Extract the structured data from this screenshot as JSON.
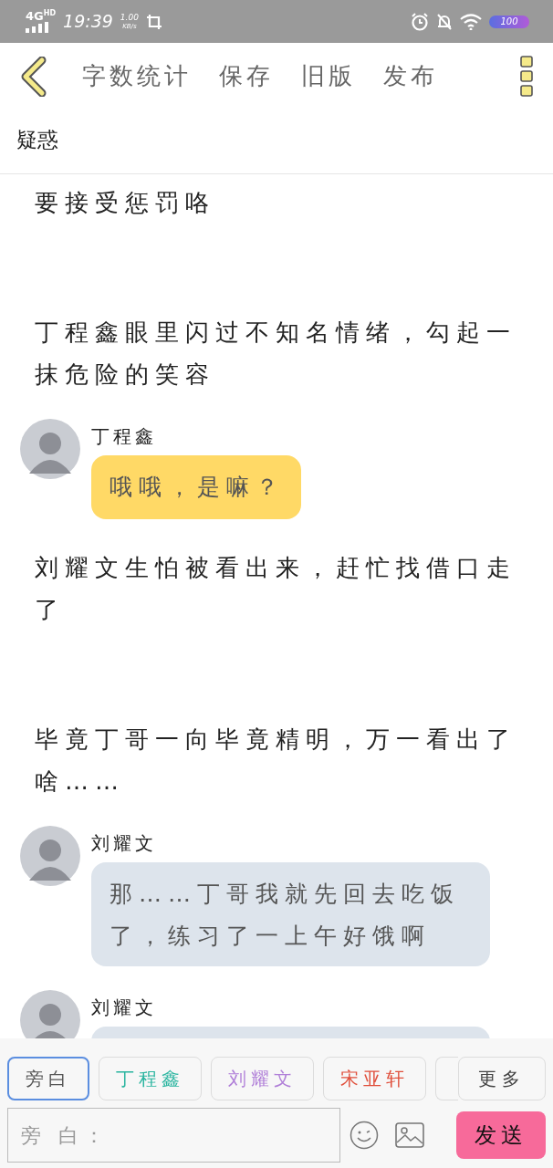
{
  "status_bar": {
    "network": "4G",
    "network_badge": "HD",
    "time": "19:39",
    "speed": "1.00",
    "speed_unit": "KB/s",
    "battery": "100"
  },
  "toolbar": {
    "actions": [
      "字数统计",
      "保存",
      "旧版",
      "发布"
    ]
  },
  "title": "疑惑",
  "story": [
    {
      "kind": "narration",
      "text": "要接受惩罚咯"
    },
    {
      "kind": "narration",
      "text": "丁程鑫眼里闪过不知名情绪，勾起一抹危险的笑容"
    },
    {
      "kind": "message",
      "speaker": "丁程鑫",
      "text": "哦哦，是嘛？",
      "color": "#ffd966"
    },
    {
      "kind": "narration",
      "text": "刘耀文生怕被看出来，赶忙找借口走了"
    },
    {
      "kind": "narration",
      "text": "毕竟丁哥一向毕竟精明，万一看出了啥……"
    },
    {
      "kind": "message",
      "speaker": "刘耀文",
      "text": "那……丁哥我就先回去吃饭了，练习了一上午好饿啊",
      "color": "#dde4ec"
    },
    {
      "kind": "message",
      "speaker": "刘耀文",
      "color": "#dde4ec"
    }
  ],
  "roles": [
    {
      "label": "旁白",
      "selected": true,
      "color": "#555555"
    },
    {
      "label": "丁程鑫",
      "selected": false,
      "color": "#2bb5a0"
    },
    {
      "label": "刘耀文",
      "selected": false,
      "color": "#b07fd8"
    },
    {
      "label": "宋亚轩",
      "selected": false,
      "color": "#e0503c"
    },
    {
      "selected": false
    }
  ],
  "more_button": "更多",
  "composer": {
    "placeholder": "旁 白：",
    "send": "发送"
  }
}
